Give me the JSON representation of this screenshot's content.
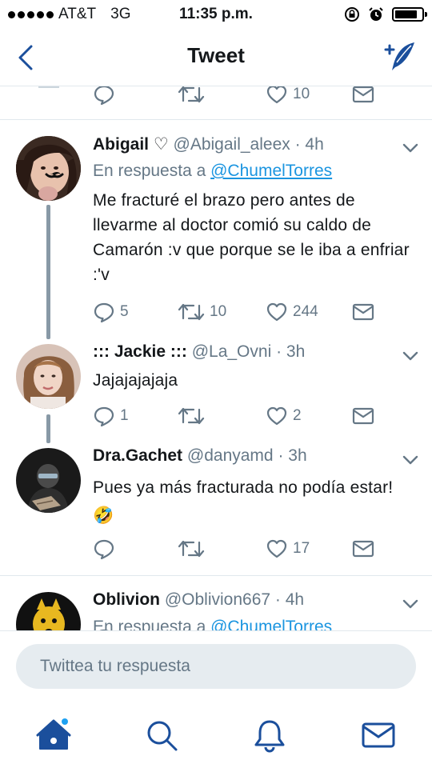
{
  "status_bar": {
    "carrier": "AT&T",
    "network": "3G",
    "time": "11:35 p.m.",
    "battery_level": 0.85
  },
  "nav": {
    "title": "Tweet",
    "back_icon": "chevron-left-icon",
    "compose_icon": "compose-tweet-icon"
  },
  "top_actions": {
    "reply_count": "",
    "retweet_count": "",
    "like_count": "10"
  },
  "tweets": [
    {
      "name": "Abigail ♡",
      "handle": "@Abigail_aleex",
      "time": "· 4h",
      "reply_prefix": "En respuesta a",
      "reply_to": "@ChumelTorres",
      "text": "Me fracturé el brazo pero antes de llevarme al doctor comió su caldo de Camarón :v que porque se le iba a enfriar :'v",
      "reply_count": "5",
      "retweet_count": "10",
      "like_count": "244"
    },
    {
      "name": "::: Jackie :::",
      "handle": "@La_Ovni",
      "time": "· 3h",
      "text": "Jajajajajaja",
      "reply_count": "1",
      "retweet_count": "",
      "like_count": "2"
    },
    {
      "name": "Dra.Gachet",
      "handle": "@danyamd",
      "time": "· 3h",
      "text": "Pues ya más fracturada no podía estar! 🤣",
      "reply_count": "",
      "retweet_count": "",
      "like_count": "17"
    },
    {
      "name": "Oblivion",
      "handle": "@Oblivion667",
      "time": "· 4h",
      "reply_prefix": "En respuesta a",
      "reply_to": "@ChumelTorres"
    }
  ],
  "composer": {
    "placeholder": "Twittea tu respuesta"
  },
  "tabbar": {
    "home": "home-icon",
    "search": "search-icon",
    "notifications": "bell-icon",
    "messages": "mail-icon"
  },
  "colors": {
    "accent": "#1da1f2",
    "link": "#1b95e0",
    "secondary": "#657786",
    "nav_icon": "#1b4f9c"
  }
}
